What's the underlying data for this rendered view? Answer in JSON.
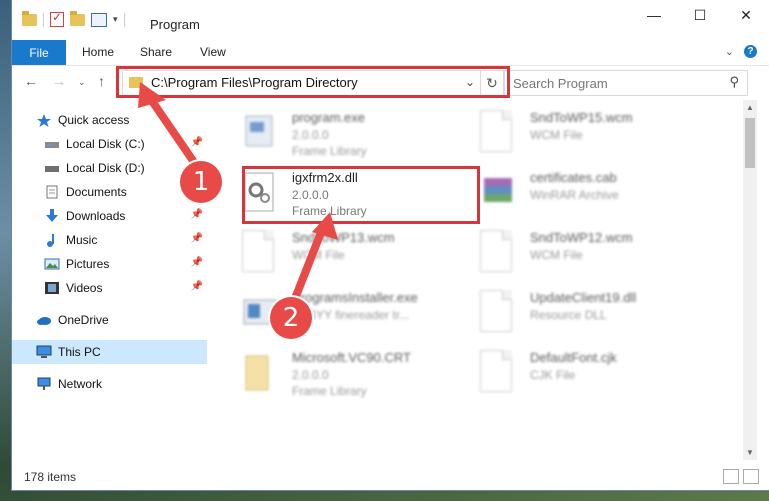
{
  "window": {
    "title": "Program"
  },
  "ribbon": {
    "tabs": [
      "File",
      "Home",
      "Share",
      "View"
    ]
  },
  "navigation": {
    "address_path": "C:\\Program Files\\Program Directory",
    "search_placeholder": "Search Program"
  },
  "sidebar": {
    "items": [
      {
        "label": "Quick access",
        "icon": "star-icon"
      },
      {
        "label": "Local Disk (C:)",
        "icon": "drive-icon",
        "pinned": true
      },
      {
        "label": "Local Disk (D:)",
        "icon": "drive-icon"
      },
      {
        "label": "Documents",
        "icon": "documents-icon",
        "pinned": true
      },
      {
        "label": "Downloads",
        "icon": "download-icon",
        "pinned": true
      },
      {
        "label": "Music",
        "icon": "music-icon",
        "pinned": true
      },
      {
        "label": "Pictures",
        "icon": "pictures-icon",
        "pinned": true
      },
      {
        "label": "Videos",
        "icon": "videos-icon",
        "pinned": true
      },
      {
        "label": "OneDrive",
        "icon": "cloud-icon"
      },
      {
        "label": "This PC",
        "icon": "computer-icon",
        "selected": true
      },
      {
        "label": "Network",
        "icon": "network-icon"
      }
    ]
  },
  "files": [
    {
      "name": "program.exe",
      "version": "2.0.0.0",
      "type": "Frame Library",
      "icon": "exe-icon",
      "highlighted": false
    },
    {
      "name": "SndToWP15.wcm",
      "version": "",
      "type": "WCM File",
      "icon": "document-icon",
      "highlighted": false
    },
    {
      "name": "igxfrm2x.dll",
      "version": "2.0.0.0",
      "type": "Frame Library",
      "icon": "dll-gear-icon",
      "highlighted": true
    },
    {
      "name": "certificates.cab",
      "version": "",
      "type": "WinRAR Archive",
      "icon": "archive-icon",
      "highlighted": false
    },
    {
      "name": "SndToWP13.wcm",
      "version": "",
      "type": "WCM File",
      "icon": "document-icon",
      "highlighted": false
    },
    {
      "name": "SndToWP12.wcm",
      "version": "",
      "type": "WCM File",
      "icon": "document-icon",
      "highlighted": false
    },
    {
      "name": "ProgramsInstaller.exe",
      "version": "ABBYY finereader tr...",
      "type": "",
      "icon": "installer-icon",
      "highlighted": false
    },
    {
      "name": "UpdateClient19.dll",
      "version": "",
      "type": "Resource DLL",
      "icon": "document-icon",
      "highlighted": false
    },
    {
      "name": "Microsoft.VC90.CRT",
      "version": "2.0.0.0",
      "type": "Frame Library",
      "icon": "folder-icon",
      "highlighted": false
    },
    {
      "name": "DefaultFont.cjk",
      "version": "",
      "type": "CJK File",
      "icon": "document-icon",
      "highlighted": false
    }
  ],
  "status": {
    "item_count": "178 items"
  },
  "annotations": {
    "step_one": "1",
    "step_two": "2",
    "color": "#d6363a"
  }
}
